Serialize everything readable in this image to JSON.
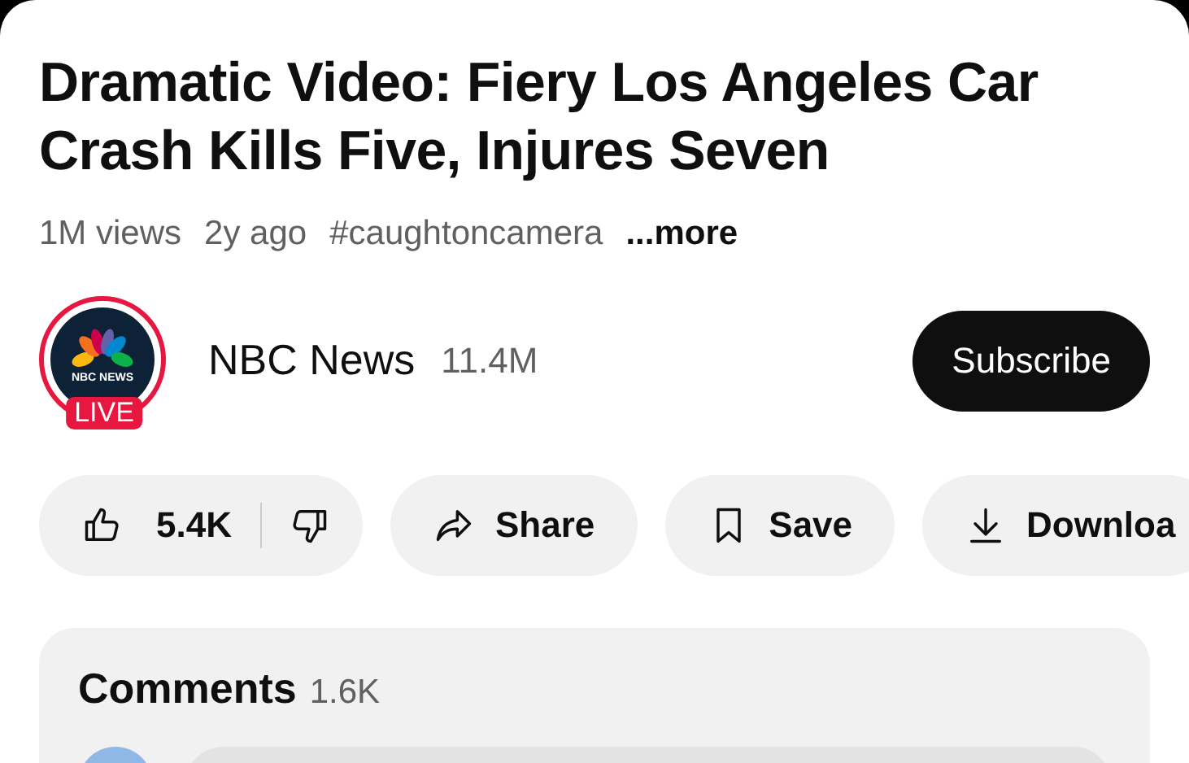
{
  "video": {
    "title": "Dramatic Video: Fiery Los Angeles Car Crash Kills Five, Injures Seven",
    "views": "1M views",
    "age": "2y ago",
    "hashtag": "#caughtoncamera",
    "more": "...more"
  },
  "channel": {
    "logo_text": "NBC NEWS",
    "live_badge": "LIVE",
    "name": "NBC News",
    "subscribers": "11.4M",
    "subscribe_button": "Subscribe"
  },
  "actions": [
    {
      "kind": "like",
      "label": "5.4K"
    },
    {
      "kind": "share",
      "label": "Share"
    },
    {
      "kind": "save",
      "label": "Save"
    },
    {
      "kind": "download",
      "label": "Downloa"
    }
  ],
  "comments": {
    "title": "Comments",
    "count": "1.6K"
  }
}
